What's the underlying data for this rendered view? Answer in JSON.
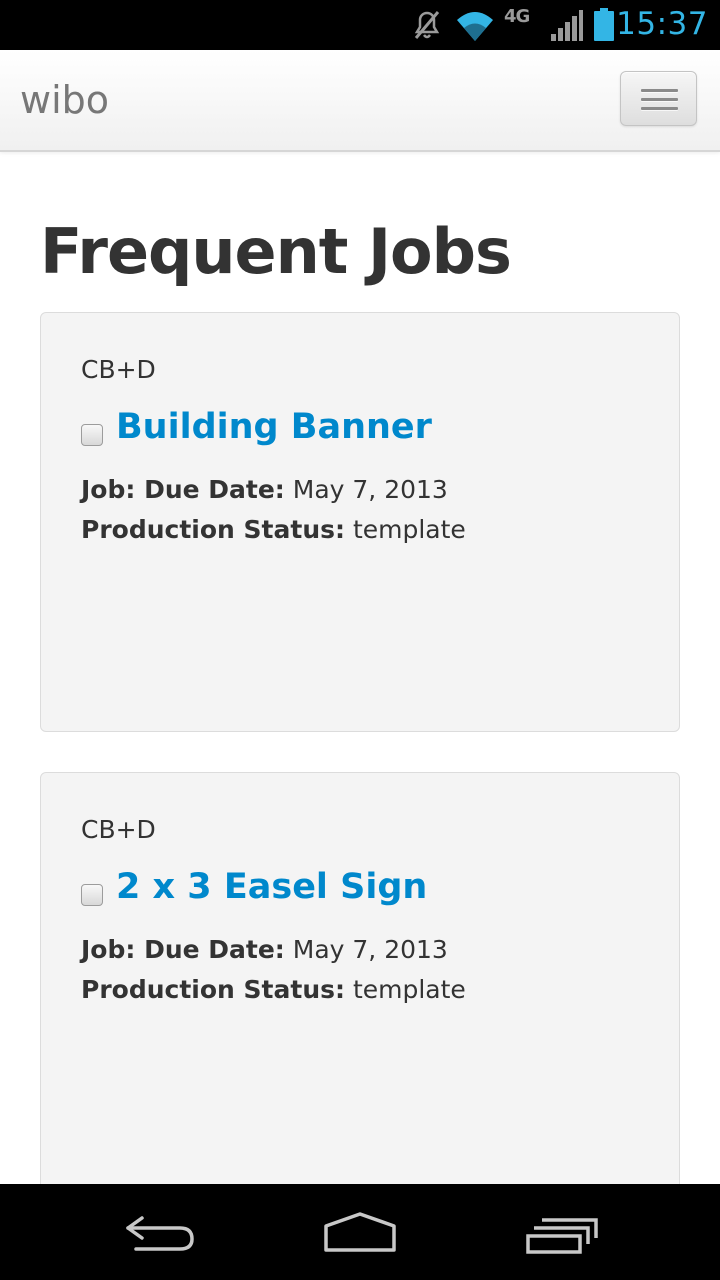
{
  "status_bar": {
    "time": "15:37",
    "network_type": "4G",
    "icons": [
      "mute-icon",
      "wifi-icon",
      "cell-signal-icon",
      "battery-icon"
    ],
    "accent_color": "#33b5e5"
  },
  "navbar": {
    "brand": "wibo",
    "menu_icon": "hamburger-menu-icon"
  },
  "page": {
    "title": "Frequent Jobs"
  },
  "jobs": [
    {
      "client": "CB+D",
      "title": "Building Banner",
      "checked": false,
      "due_label": "Job: Due Date:",
      "due_value": "May 7, 2013",
      "status_label": "Production Status:",
      "status_value": "template"
    },
    {
      "client": "CB+D",
      "title": "2 x 3 Easel Sign",
      "checked": false,
      "due_label": "Job: Due Date:",
      "due_value": "May 7, 2013",
      "status_label": "Production Status:",
      "status_value": "template"
    }
  ],
  "colors": {
    "link": "#0088cc",
    "text": "#333333",
    "card_background": "#f4f4f4"
  },
  "system_nav": {
    "icons": [
      "back-icon",
      "home-icon",
      "recent-apps-icon"
    ]
  }
}
